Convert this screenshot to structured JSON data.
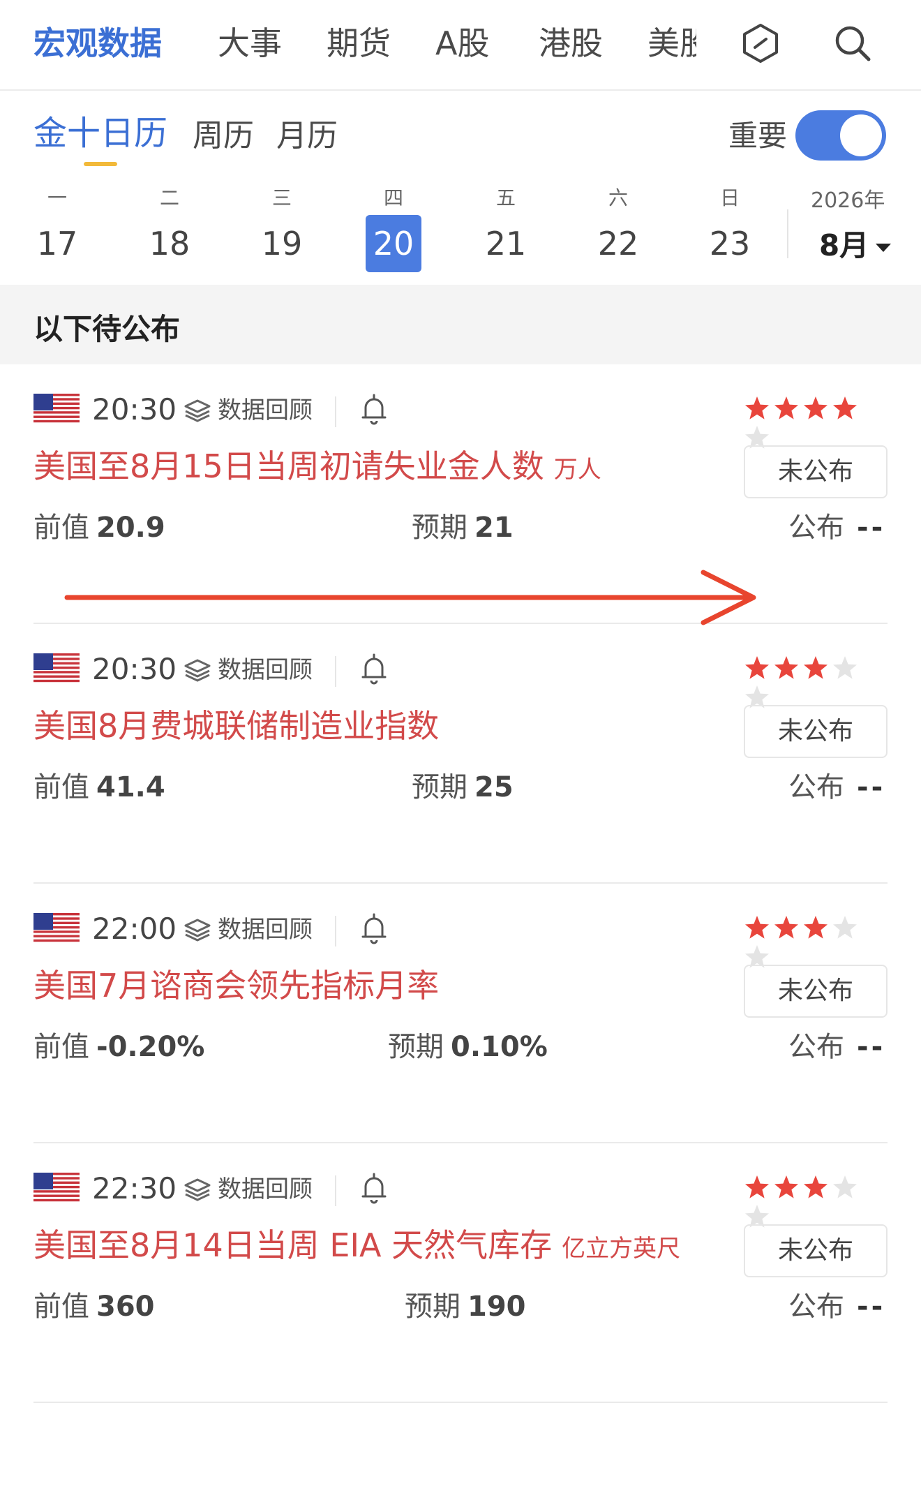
{
  "topnav": {
    "tabs": [
      "宏观数据",
      "大事",
      "期货",
      "A股",
      "港股",
      "美股"
    ],
    "active": "宏观数据",
    "icons": [
      "hexagon-icon",
      "search-icon"
    ]
  },
  "subtabs": {
    "items": [
      "金十日历",
      "周历",
      "月历"
    ],
    "active": "金十日历",
    "important_label": "重要",
    "important_on": true
  },
  "week": {
    "days": [
      {
        "weekday": "一",
        "date": "17"
      },
      {
        "weekday": "二",
        "date": "18"
      },
      {
        "weekday": "三",
        "date": "19"
      },
      {
        "weekday": "四",
        "date": "20"
      },
      {
        "weekday": "五",
        "date": "21"
      },
      {
        "weekday": "六",
        "date": "22"
      },
      {
        "weekday": "日",
        "date": "23"
      }
    ],
    "selected": "20",
    "year": "2026年",
    "month": "8月"
  },
  "section_title": "以下待公布",
  "labels": {
    "review": "数据回顾",
    "prev": "前值",
    "forecast": "预期",
    "actual": "公布",
    "status": "未公布"
  },
  "events": [
    {
      "time": "20:30",
      "title": "美国至8月15日当周初请失业金人数",
      "unit": "万人",
      "stars": 4,
      "prev": "20.9",
      "forecast": "21",
      "actual": "--"
    },
    {
      "time": "20:30",
      "title": "美国8月费城联储制造业指数",
      "unit": "",
      "stars": 3,
      "prev": "41.4",
      "forecast": "25",
      "actual": "--"
    },
    {
      "time": "22:00",
      "title": "美国7月谘商会领先指标月率",
      "unit": "",
      "stars": 3,
      "prev": "-0.20%",
      "forecast": "0.10%",
      "actual": "--"
    },
    {
      "time": "22:30",
      "title": "美国至8月14日当周 EIA 天然气库存",
      "unit": "亿立方英尺",
      "stars": 3,
      "prev": "360",
      "forecast": "190",
      "actual": "--"
    }
  ],
  "colors": {
    "accent": "#3b6fd4",
    "title_red": "#d24a4a",
    "star_on": "#e8453c",
    "star_off": "#e4e4e4",
    "arrow": "#e8452e"
  }
}
